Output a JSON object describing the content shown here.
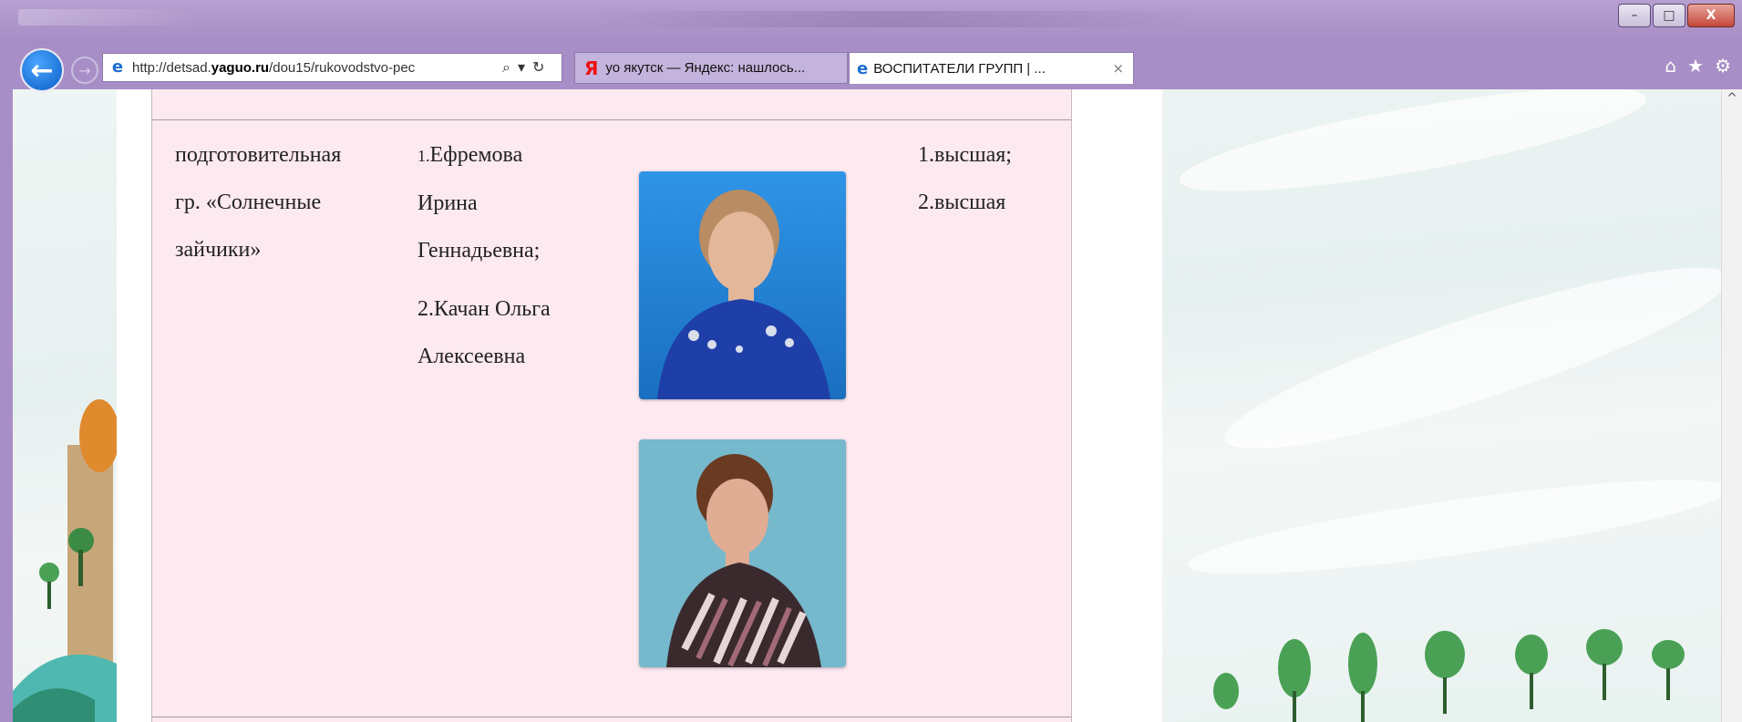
{
  "browser": {
    "address_url_prefix": "http://detsad.",
    "address_url_domain": "yaguo.ru",
    "address_url_suffix": "/dou15/rukovodstvo-pec",
    "search_icon": "search-icon",
    "refresh_icon": "refresh-icon",
    "tabs": [
      {
        "label": "уо якутск — Яндекс: нашлось...",
        "favicon": "yandex-icon",
        "active": false
      },
      {
        "label": "ВОСПИТАТЕЛИ ГРУПП | ...",
        "favicon": "ie-icon",
        "active": true,
        "close": "×"
      }
    ],
    "window_controls": {
      "minimize": "–",
      "maximize": "□",
      "close": "X"
    },
    "right_icons": [
      "home-icon",
      "star-icon",
      "gear-icon"
    ]
  },
  "row": {
    "group_lines": [
      "подготовительная",
      "гр. «Солнечные",
      "зайчики»"
    ],
    "teacher1_lines": [
      "Ефремова",
      "Ирина",
      "Геннадьевна;"
    ],
    "teacher1_num": "1.",
    "teacher2_lines": [
      "2.Качан Ольга",
      "Алексеевна"
    ],
    "category_lines": [
      "1.высшая;",
      "2.высшая"
    ]
  },
  "colors": {
    "chrome": "#a88ec6",
    "panel_pink": "#fde9f0"
  }
}
